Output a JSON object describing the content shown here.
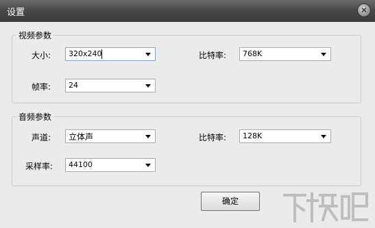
{
  "window": {
    "title": "设置",
    "close_glyph": "✕"
  },
  "video": {
    "legend": "视频参数",
    "size_label": "大小:",
    "size_value": "320x240",
    "bitrate_label": "比特率:",
    "bitrate_value": "768K",
    "fps_label": "帧率:",
    "fps_value": "24"
  },
  "audio": {
    "legend": "音频参数",
    "channel_label": "声道:",
    "channel_value": "立体声",
    "bitrate_label": "比特率:",
    "bitrate_value": "128K",
    "samplerate_label": "采样率:",
    "samplerate_value": "44100"
  },
  "buttons": {
    "ok_label": "确定"
  },
  "watermark": {
    "text": "下载吧"
  }
}
